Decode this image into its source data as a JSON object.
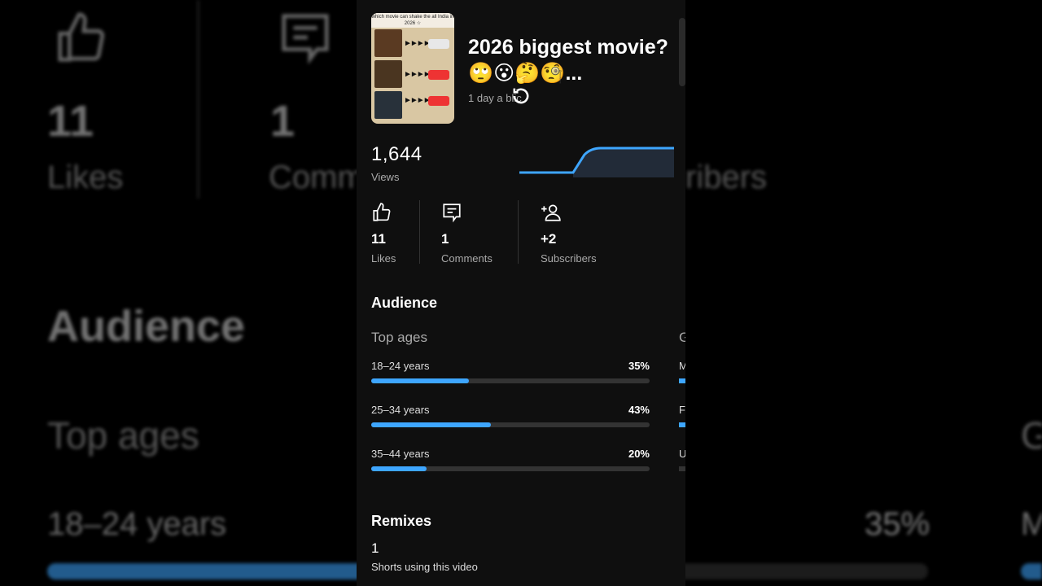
{
  "video": {
    "title": "2026 biggest movie?🙄😮🤔🧐...",
    "meta": "1 day a   blic",
    "thumbnail_caption": "which movie can shake the all India in 2026 ☆"
  },
  "views": {
    "value": "1,644",
    "label": "Views"
  },
  "metrics": [
    {
      "icon": "thumbs-up-icon",
      "value": "11",
      "label": "Likes"
    },
    {
      "icon": "comment-icon",
      "value": "1",
      "label": "Comments"
    },
    {
      "icon": "add-person-icon",
      "value": "+2",
      "label": "Subscribers"
    }
  ],
  "audience": {
    "heading": "Audience",
    "top_ages_label": "Top ages",
    "gender_initial": "G",
    "ages": [
      {
        "label": "18–24 years",
        "pct": "35%",
        "fraction": 0.35,
        "side": "M"
      },
      {
        "label": "25–34 years",
        "pct": "43%",
        "fraction": 0.43,
        "side": "F"
      },
      {
        "label": "35–44 years",
        "pct": "20%",
        "fraction": 0.2,
        "side": "U"
      }
    ]
  },
  "remixes": {
    "heading": "Remixes",
    "value": "1",
    "label": "Shorts using this video"
  },
  "backdrop": {
    "likes_value": "11",
    "likes_label": "Likes",
    "comments_value": "1",
    "comments_label": "Comm",
    "subscribers_label": "ribers",
    "audience_heading": "Audience",
    "top_ages_label": "Top ages",
    "gender_initial": "G",
    "age_label": "18–24 years",
    "age_pct": "35%",
    "side_initial": "M"
  },
  "colors": {
    "accent": "#3ea6ff",
    "background": "#0f0f0f",
    "track": "#333333"
  }
}
